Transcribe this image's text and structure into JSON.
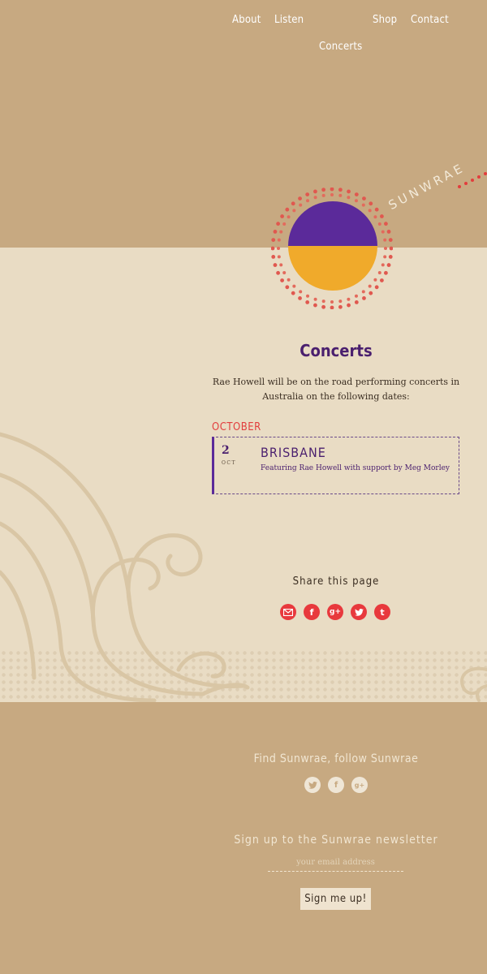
{
  "nav": {
    "items": [
      {
        "label": "About"
      },
      {
        "label": "Listen"
      },
      {
        "label": "Shop"
      },
      {
        "label": "Contact"
      },
      {
        "label": "Concerts"
      }
    ]
  },
  "brand": {
    "name": "SUNWRAE"
  },
  "page": {
    "title": "Concerts",
    "intro": "Rae Howell will be on the road performing concerts in Australia on the following dates:"
  },
  "concerts": {
    "month": "OCTOBER",
    "events": [
      {
        "day": "2",
        "month_abbr": "OCT",
        "city": "BRISBANE",
        "description": "Featuring Rae Howell with support by Meg Morley"
      }
    ]
  },
  "share": {
    "title": "Share this page",
    "icons": [
      "email-icon",
      "facebook-icon",
      "google-plus-icon",
      "twitter-icon",
      "tumblr-icon"
    ]
  },
  "footer": {
    "follow_title": "Find Sunwrae, follow Sunwrae",
    "social_icons": [
      "twitter-icon",
      "facebook-icon",
      "google-plus-icon"
    ],
    "newsletter_title": "Sign up to the Sunwrae newsletter",
    "email_placeholder": "your email address",
    "signup_label": "Sign me up!"
  },
  "colors": {
    "kraft": "#c7a981",
    "paper": "#e9dcc4",
    "purple": "#5b2a9a",
    "amber": "#f0aa2b",
    "accent_red": "#e8393d"
  }
}
